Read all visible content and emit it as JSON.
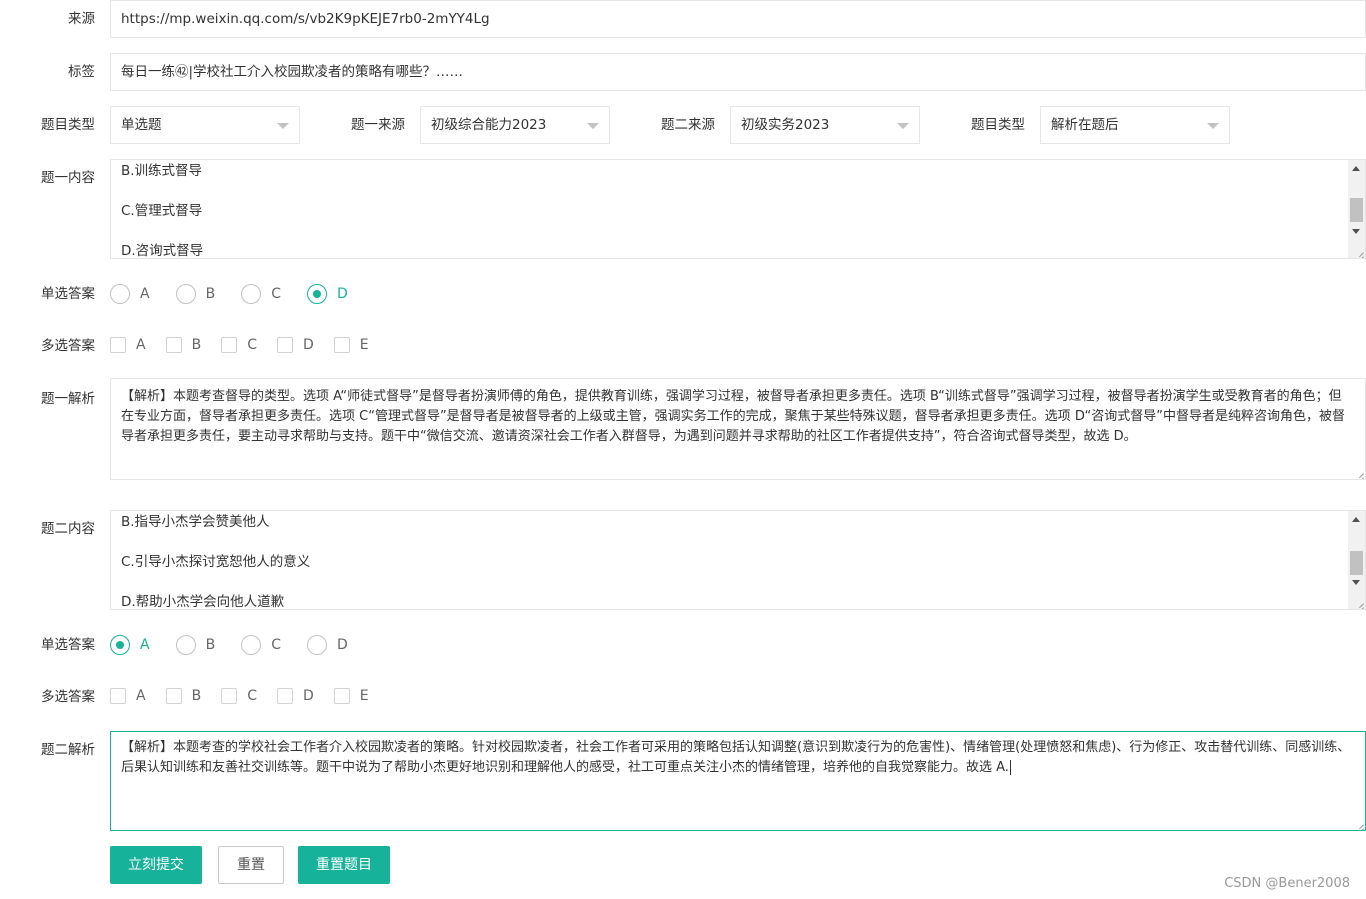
{
  "source": {
    "label": "来源",
    "value": "https://mp.weixin.qq.com/s/vb2K9pKEJE7rb0-2mYY4Lg"
  },
  "tag": {
    "label": "标签",
    "value": "每日一练㊷|学校社工介入校园欺凌者的策略有哪些？……"
  },
  "selects": {
    "type_label": "题目类型",
    "type_value": "单选题",
    "src1_label": "题一来源",
    "src1_value": "初级综合能力2023",
    "src2_label": "题二来源",
    "src2_value": "初级实务2023",
    "type2_label": "题目类型",
    "type2_value": "解析在题后"
  },
  "q1": {
    "content_label": "题一内容",
    "content_lines": [
      "B.训练式督导",
      "C.管理式督导",
      "D.咨询式督导"
    ],
    "single_label": "单选答案",
    "single_options": [
      "A",
      "B",
      "C",
      "D"
    ],
    "single_selected": "D",
    "multi_label": "多选答案",
    "multi_options": [
      "A",
      "B",
      "C",
      "D",
      "E"
    ],
    "analysis_label": "题一解析",
    "analysis_text": "【解析】本题考查督导的类型。选项 A“师徒式督导”是督导者扮演师傅的角色，提供教育训练，强调学习过程，被督导者承担更多责任。选项 B“训练式督导”强调学习过程，被督导者扮演学生或受教育者的角色；但在专业方面，督导者承担更多责任。选项 C“管理式督导”是督导者是被督导者的上级或主管，强调实务工作的完成，聚焦于某些特殊议题，督导者承担更多责任。选项 D“咨询式督导”中督导者是纯粹咨询角色，被督导者承担更多责任，要主动寻求帮助与支持。题干中“微信交流、邀请资深社会工作者入群督导，为遇到问题并寻求帮助的社区工作者提供支持”，符合咨询式督导类型，故选 D。"
  },
  "q2": {
    "content_label": "题二内容",
    "content_lines": [
      "B.指导小杰学会赞美他人",
      "C.引导小杰探讨宽恕他人的意义",
      "D.帮助小杰学会向他人道歉"
    ],
    "single_label": "单选答案",
    "single_options": [
      "A",
      "B",
      "C",
      "D"
    ],
    "single_selected": "A",
    "multi_label": "多选答案",
    "multi_options": [
      "A",
      "B",
      "C",
      "D",
      "E"
    ],
    "analysis_label": "题二解析",
    "analysis_text": "【解析】本题考查的学校社会工作者介入校园欺凌者的策略。针对校园欺凌者，社会工作者可采用的策略包括认知调整(意识到欺凌行为的危害性)、情绪管理(处理愤怒和焦虑)、行为修正、攻击替代训练、同感训练、后果认知训练和友善社交训练等。题干中说为了帮助小杰更好地识别和理解他人的感受，社工可重点关注小杰的情绪管理，培养他的自我觉察能力。故选 A."
  },
  "buttons": {
    "submit": "立刻提交",
    "reset": "重置",
    "reset_question": "重置题目"
  },
  "watermark": "CSDN @Bener2008",
  "colors": {
    "accent": "#16b29a",
    "border": "#e6e6e6"
  }
}
